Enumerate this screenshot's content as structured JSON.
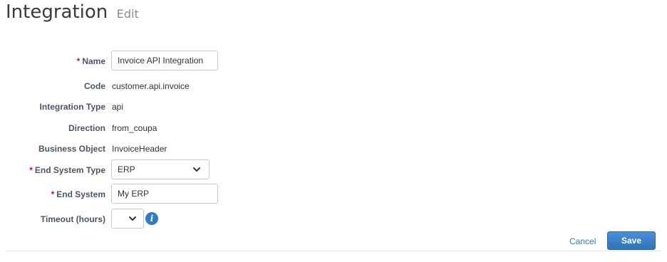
{
  "header": {
    "title": "Integration",
    "subtitle": "Edit"
  },
  "form": {
    "name": {
      "label": "Name",
      "required_mark": "*",
      "value": "Invoice API Integration"
    },
    "code": {
      "label": "Code",
      "value": "customer.api.invoice"
    },
    "integration_type": {
      "label": "Integration Type",
      "value": "api"
    },
    "direction": {
      "label": "Direction",
      "value": "from_coupa"
    },
    "business_object": {
      "label": "Business Object",
      "value": "InvoiceHeader"
    },
    "end_system_type": {
      "label": "End System Type",
      "required_mark": "*",
      "value": "ERP"
    },
    "end_system": {
      "label": "End System",
      "required_mark": "*",
      "value": "My ERP"
    },
    "timeout": {
      "label": "Timeout (hours)",
      "value": "",
      "info_icon": "info-icon"
    }
  },
  "actions": {
    "cancel_label": "Cancel",
    "save_label": "Save"
  },
  "colors": {
    "accent": "#2f7bc4",
    "required": "#c8102e",
    "label": "#4b5563"
  }
}
